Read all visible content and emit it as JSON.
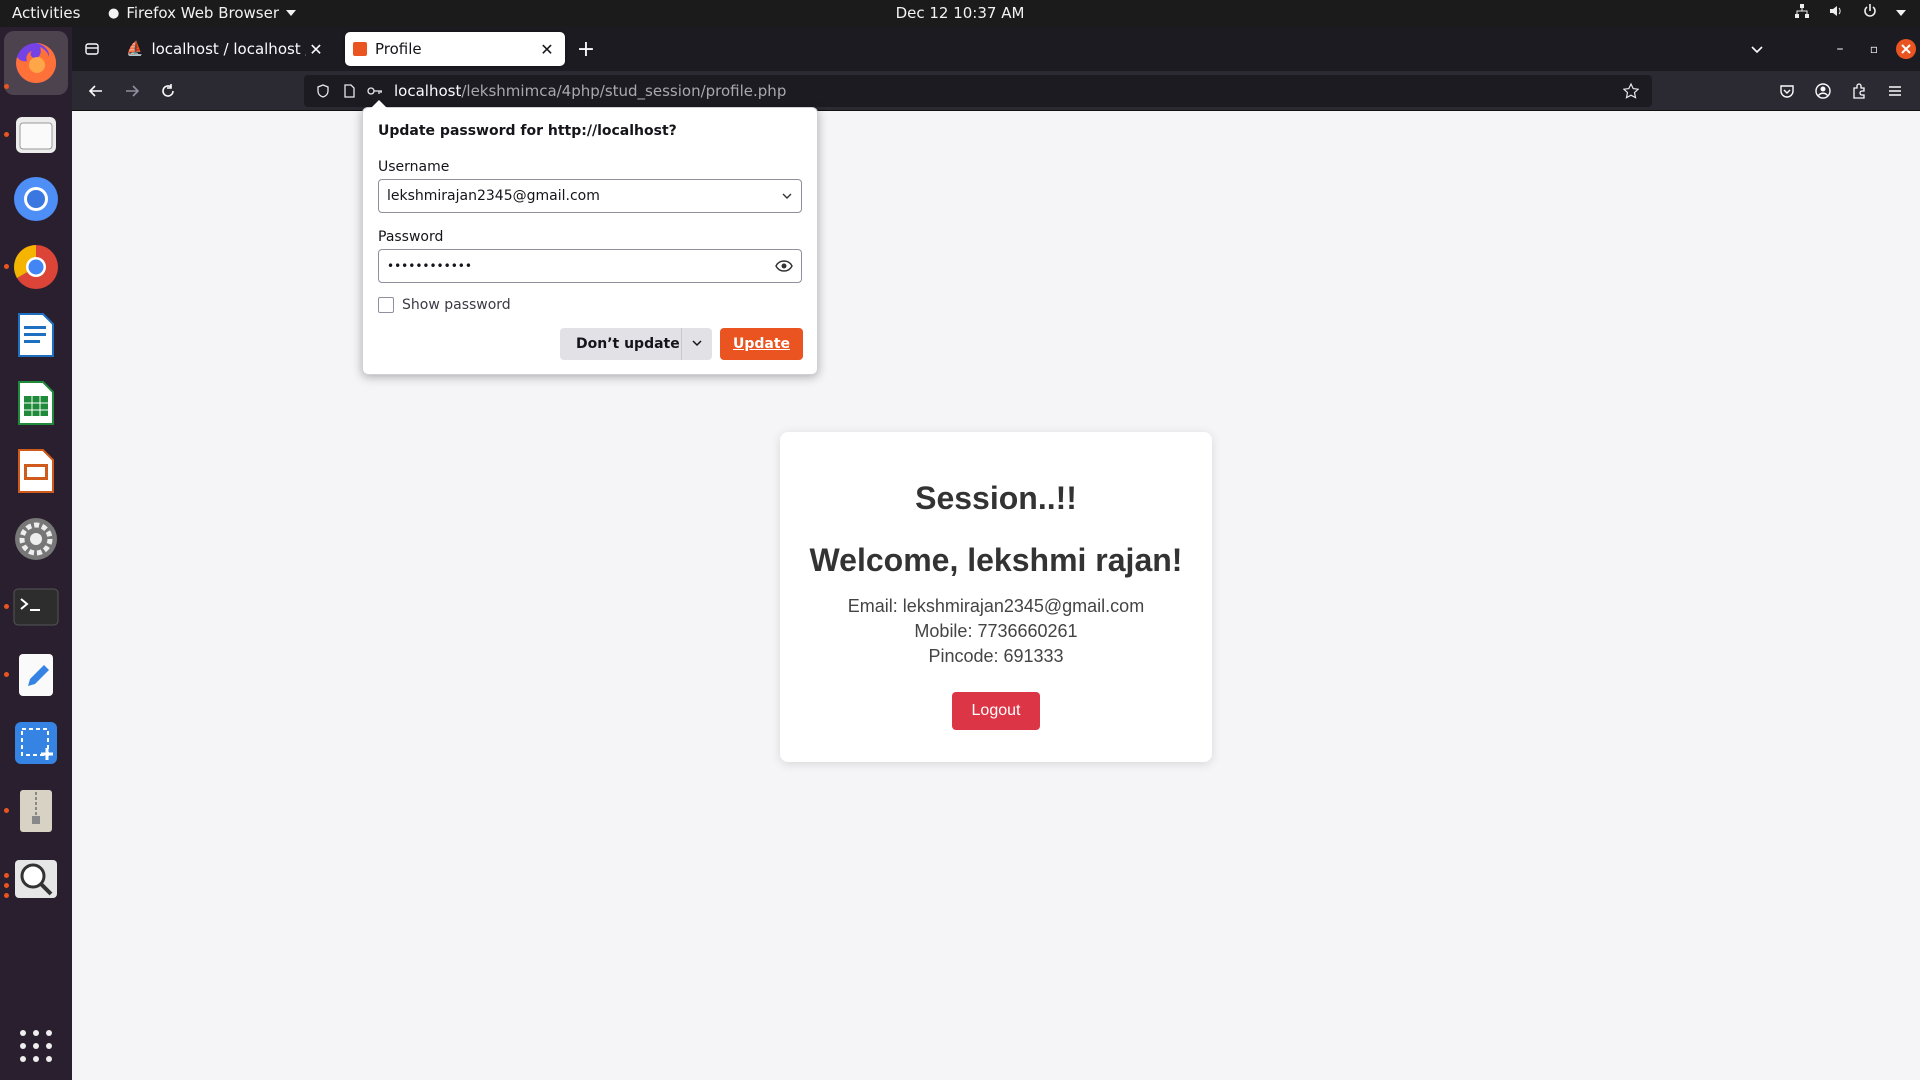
{
  "topbar": {
    "activities": "Activities",
    "app_name": "Firefox Web Browser",
    "clock": "Dec 12  10:37 AM"
  },
  "browser": {
    "tabs": [
      {
        "label": "localhost / localhost / stu"
      },
      {
        "label": "Profile"
      }
    ],
    "url_host": "localhost",
    "url_path": "/lekshmimca/4php/stud_session/profile.php"
  },
  "doorhanger": {
    "title": "Update password for http://localhost?",
    "username_label": "Username",
    "username_value": "lekshmirajan2345@gmail.com",
    "password_label": "Password",
    "password_value": "••••••••••••",
    "show_password_label": "Show password",
    "dont_update_label": "Don’t update",
    "update_label": "Update"
  },
  "page": {
    "heading": "Session..!!",
    "welcome": "Welcome, lekshmi rajan!",
    "email": "Email: lekshmirajan2345@gmail.com",
    "mobile": "Mobile: 7736660261",
    "pincode": "Pincode: 691333",
    "logout_label": "Logout"
  },
  "colors": {
    "accent": "#e95420",
    "logout": "#dc3545"
  }
}
